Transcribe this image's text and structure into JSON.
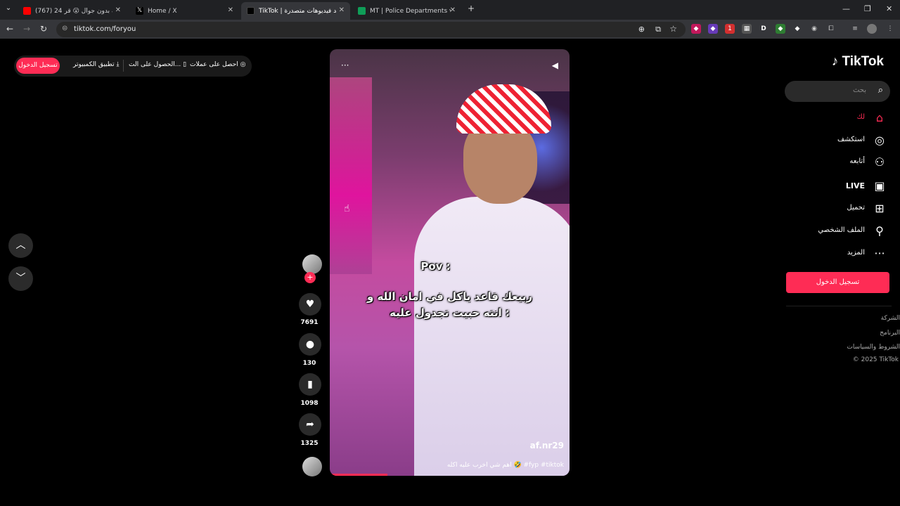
{
  "browser": {
    "tabs": [
      {
        "title": "(767) 24 ساعة بدون جوال 😮 قر",
        "favicon_color": "#ff0000"
      },
      {
        "title": "Home / X",
        "favicon_color": "#000000"
      },
      {
        "title": "TikTok | شاهد فيديوهات متصدرة",
        "favicon_color": "#000000"
      },
      {
        "title": "MT | Police Departments v7.0 -",
        "favicon_color": "#0f9d58"
      }
    ],
    "url": "tiktok.com/foryou",
    "new_tab": "+",
    "ext_badge": "1"
  },
  "topbar": {
    "login": "تسجيل الدخول",
    "desktop_app": "تطبيق الكمبيوتر",
    "get_app": "الحصول على الت...",
    "coins": "احصل على عملات"
  },
  "video": {
    "caption_pov": "Pov :",
    "caption_line1": "ربيعك قاعد ياكل في امان الله و",
    "caption_line2": "انته حبيت تجدول عليه :",
    "author": "af.nr29",
    "description": "اهم شي اخرب عليه اكله 🤣 #fyp #tiktok",
    "more": "···",
    "progress_fraction": 0.24
  },
  "actions": {
    "likes": "7691",
    "comments": "130",
    "saves": "1098",
    "shares": "1325"
  },
  "sidebar": {
    "logo": "TikTok",
    "search_placeholder": "بحث",
    "items": [
      {
        "label": "لك",
        "icon": "home-icon"
      },
      {
        "label": "استكشف",
        "icon": "compass-icon"
      },
      {
        "label": "أتابعه",
        "icon": "following-icon"
      },
      {
        "label": "LIVE",
        "icon": "live-icon"
      },
      {
        "label": "تحميل",
        "icon": "upload-icon"
      },
      {
        "label": "الملف الشخصي",
        "icon": "profile-icon"
      },
      {
        "label": "المزيد",
        "icon": "more-icon"
      }
    ],
    "login": "تسجيل الدخول",
    "footer": [
      "الشركة",
      "البرنامج",
      "الشروط والسياسات",
      "© 2025 TikTok"
    ]
  },
  "colors": {
    "accent": "#fe2c55"
  }
}
